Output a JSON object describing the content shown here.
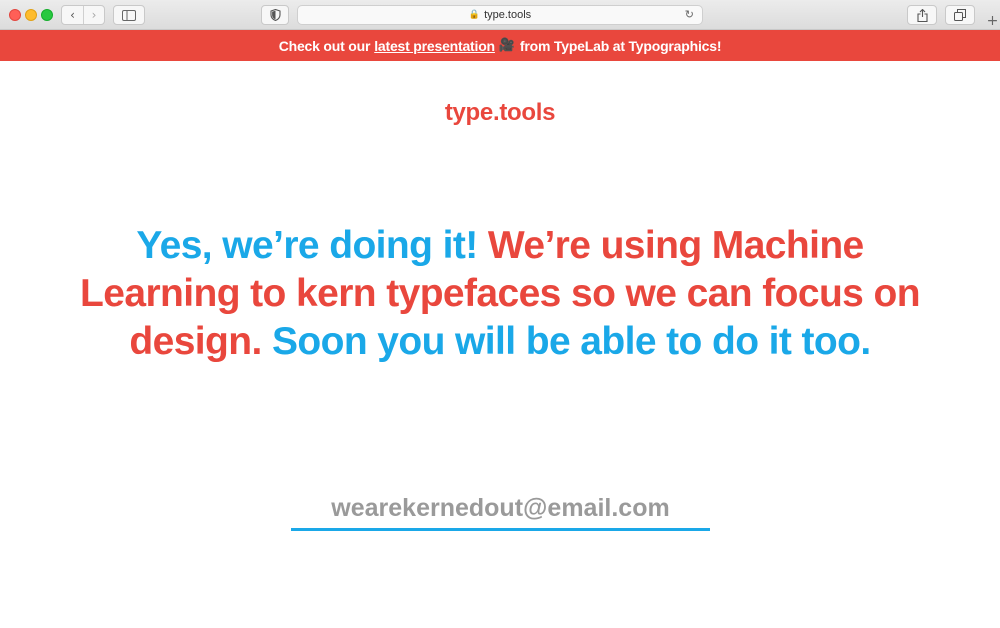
{
  "browser": {
    "url": "type.tools",
    "icons": {
      "back": "chevron-left-icon",
      "forward": "chevron-right-icon",
      "sidebar": "sidebar-icon",
      "privacy": "shield-icon",
      "lock": "lock-icon",
      "reload": "reload-icon",
      "share": "share-icon",
      "tabs": "tabs-icon",
      "new_tab": "plus-icon"
    }
  },
  "banner": {
    "prefix": "Check out our",
    "link": "latest presentation",
    "emoji": "🎥",
    "suffix": "from TypeLab at Typographics!",
    "color": "#e9473d"
  },
  "logo": "type.tools",
  "headline": {
    "part1": "Yes, we’re doing it!",
    "part2": "We’re using Machine Learning to kern typefaces so we can focus on design.",
    "part3": "Soon you will be able to do it too."
  },
  "email": {
    "placeholder": "wearekernedout@email.com",
    "value": ""
  },
  "colors": {
    "red": "#e9473d",
    "blue": "#1aa8e8",
    "gray": "#999999"
  }
}
